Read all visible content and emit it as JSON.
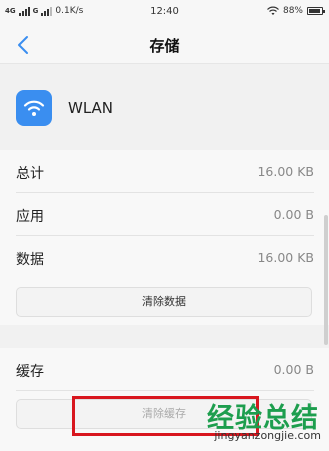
{
  "status_bar": {
    "signal_1": "4G",
    "signal_2": "G",
    "net_speed": "0.1K/s",
    "time": "12:40",
    "battery": "88%",
    "battery_level": 0.88
  },
  "title_bar": {
    "title": "存储"
  },
  "app": {
    "name": "WLAN",
    "icon": "wifi-icon",
    "icon_color": "#3a8ef0"
  },
  "storage": {
    "rows": [
      {
        "label": "总计",
        "value": "16.00 KB"
      },
      {
        "label": "应用",
        "value": "0.00 B"
      },
      {
        "label": "数据",
        "value": "16.00 KB"
      }
    ],
    "clear_data_label": "清除数据"
  },
  "cache": {
    "label": "缓存",
    "value": "0.00 B",
    "clear_cache_label": "清除缓存"
  },
  "watermark": {
    "brand": "经验总结",
    "url": "jingyanzongjie.com",
    "brand_color": "#1d9e4e"
  },
  "highlight_color": "#d8161e"
}
